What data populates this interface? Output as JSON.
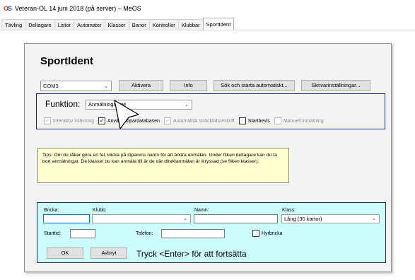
{
  "window": {
    "title": "Veteran-OL 14 juni 2018 (på server) – MeOS"
  },
  "tabs": [
    "Tävling",
    "Deltagare",
    "Listor",
    "Automater",
    "Klasser",
    "Banor",
    "Kontroller",
    "Klubbar",
    "SportIdent"
  ],
  "active_tab": "SportIdent",
  "panel": {
    "title": "SportIdent"
  },
  "toolbar": {
    "port_value": "COM3",
    "activate_label": "Aktivera",
    "info_label": "Info",
    "search_start_label": "Sök och starta automatiskt...",
    "printer_settings_label": "Skrivarinställningar..."
  },
  "function": {
    "label": "Funktion:",
    "mode_value": "Anmälningsläge"
  },
  "options": [
    {
      "label": "Interaktiv inläsning",
      "checked": true,
      "enabled": false
    },
    {
      "label": "Använd löpardatabasen",
      "checked": true,
      "enabled": true
    },
    {
      "label": "Automatisk sträcktidsutskrift",
      "checked": true,
      "enabled": false
    },
    {
      "label": "Startbevis",
      "checked": false,
      "enabled": true
    },
    {
      "label": "Manuell inmatning",
      "checked": false,
      "enabled": false
    }
  ],
  "tips": {
    "text": "Tips: Om du råkar göra en fel, klicka på löparens namn för att ändra anmälan. Under fliken deltagare kan du ta bort anmälningar. De klasser du kan anmäla till är de där direktanmälan är ikryssad (se fliken klasser)."
  },
  "entry": {
    "card_label": "Bricka:",
    "card_value": "",
    "club_label": "Klubb:",
    "club_value": "",
    "name_label": "Namn:",
    "name_value": "",
    "class_label": "Klass:",
    "class_value": "Lång (30 kartor)",
    "start_label": "Starttid:",
    "start_value": "",
    "phone_label": "Telefon:",
    "phone_value": "",
    "rent_label": "Hyrbricka",
    "rent_checked": false,
    "ok_label": "OK",
    "cancel_label": "Avbryt",
    "enter_hint": "Tryck <Enter> för att fortsätta"
  },
  "colors": {
    "entry_background": "#cdfdfd",
    "tips_background": "#ffffd2",
    "function_border": "#1c2a6e"
  }
}
